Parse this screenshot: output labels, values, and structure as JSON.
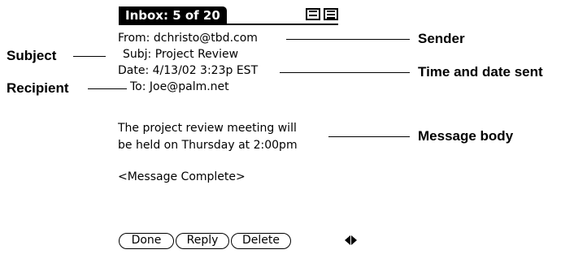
{
  "device": {
    "title": "Inbox: 5 of 20",
    "icons": [
      "full-view-icon",
      "list-view-icon"
    ]
  },
  "message": {
    "from_label": "From:",
    "from_value": "dchristo@tbd.com",
    "subj_label": "Subj:",
    "subj_value": "Project Review",
    "date_label": "Date:",
    "date_value": "4/13/02 3:23p EST",
    "to_label": "To:",
    "to_value": "Joe@palm.net",
    "body_line1": "The project review meeting will",
    "body_line2": "be held on Thursday at 2:00pm",
    "complete": "<Message Complete>"
  },
  "buttons": {
    "done": "Done",
    "reply": "Reply",
    "delete": "Delete"
  },
  "callouts": {
    "subject": "Subject",
    "recipient": "Recipient",
    "sender": "Sender",
    "time_date": "Time and date sent",
    "message_body": "Message body"
  }
}
